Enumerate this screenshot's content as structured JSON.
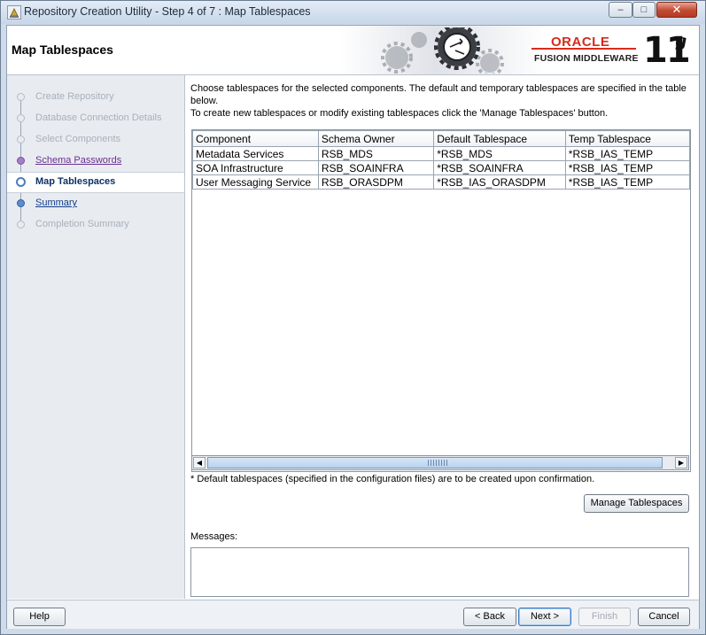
{
  "window": {
    "title": "Repository Creation Utility - Step 4 of 7 : Map Tablespaces",
    "controls": {
      "minimize": "–",
      "maximize": "□",
      "close": "✕"
    }
  },
  "header": {
    "page_title": "Map Tablespaces",
    "oracle": "ORACLE",
    "fusion": "FUSION MIDDLEWARE",
    "version_num": "11",
    "version_suffix": "g"
  },
  "nav": {
    "items": [
      {
        "label": "Create Repository",
        "state": "done"
      },
      {
        "label": "Database Connection Details",
        "state": "done"
      },
      {
        "label": "Select Components",
        "state": "done"
      },
      {
        "label": "Schema Passwords",
        "state": "visited"
      },
      {
        "label": "Map Tablespaces",
        "state": "current"
      },
      {
        "label": "Summary",
        "state": "next"
      },
      {
        "label": "Completion Summary",
        "state": "done"
      }
    ]
  },
  "main": {
    "description_line1": "Choose tablespaces for the selected components. The default and temporary tablespaces are specified in the table below.",
    "description_line2": "To create new tablespaces or modify existing tablespaces click the 'Manage Tablespaces' button.",
    "table": {
      "columns": [
        "Component",
        "Schema Owner",
        "Default Tablespace",
        "Temp Tablespace"
      ],
      "rows": [
        [
          "Metadata Services",
          "RSB_MDS",
          "*RSB_MDS",
          "*RSB_IAS_TEMP"
        ],
        [
          "SOA Infrastructure",
          "RSB_SOAINFRA",
          "*RSB_SOAINFRA",
          "*RSB_IAS_TEMP"
        ],
        [
          "User Messaging Service",
          "RSB_ORASDPM",
          "*RSB_IAS_ORASDPM",
          "*RSB_IAS_TEMP"
        ]
      ]
    },
    "footnote": "* Default tablespaces (specified in the configuration files) are to be created upon confirmation.",
    "manage_button": "Manage Tablespaces",
    "messages_label": "Messages:",
    "messages_text": ""
  },
  "footer": {
    "help": "Help",
    "back": "< Back",
    "next": "Next >",
    "finish": "Finish",
    "cancel": "Cancel"
  },
  "colors": {
    "oracle_red": "#d72b1e",
    "nav_current": "#0b3166",
    "nav_visited": "#6b2f8f"
  }
}
